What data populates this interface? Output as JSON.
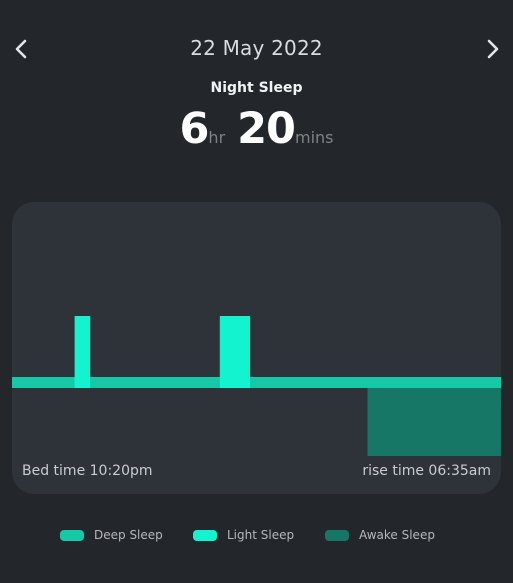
{
  "header": {
    "date": "22 May 2022",
    "prev_icon": "chevron-left-icon",
    "next_icon": "chevron-right-icon"
  },
  "summary": {
    "label": "Night Sleep",
    "hours": "6",
    "hours_unit": "hr",
    "minutes": "20",
    "minutes_unit": "mins"
  },
  "chart": {
    "bed_time": "Bed time 10:20pm",
    "rise_time": "rise time 06:35am"
  },
  "colors": {
    "background": "#23272c",
    "card": "#2d3339",
    "deep_sleep": "#15c9a6",
    "light_sleep": "#14f3d0",
    "awake_sleep": "#177767"
  },
  "legend": [
    {
      "label": "Deep Sleep",
      "color": "#15c9a6"
    },
    {
      "label": "Light Sleep",
      "color": "#14f3d0"
    },
    {
      "label": "Awake Sleep",
      "color": "#177767"
    }
  ],
  "chart_data": {
    "type": "bar",
    "series": [
      {
        "name": "Deep Sleep",
        "segments": [
          {
            "start": 0.0,
            "end": 1.0
          }
        ]
      },
      {
        "name": "Light Sleep",
        "segments": [
          {
            "start": 0.128,
            "end": 0.16
          },
          {
            "start": 0.425,
            "end": 0.487
          }
        ]
      },
      {
        "name": "Awake Sleep",
        "segments": [
          {
            "start": 0.727,
            "end": 1.0
          }
        ]
      }
    ]
  }
}
